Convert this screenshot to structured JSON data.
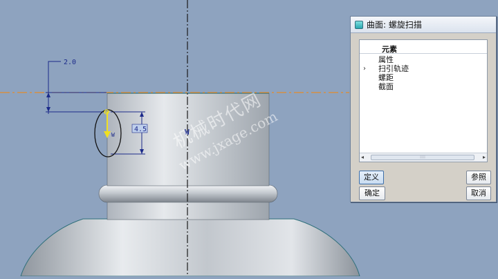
{
  "viewport": {
    "background_color": "#8ea3bf",
    "dimension_horizontal": "2.0",
    "dimension_height": "4.5",
    "axis_marker": "W",
    "cursor_marker": "W"
  },
  "watermark": {
    "line1": "机械时代网",
    "line2": "www.jxage.com"
  },
  "dialog": {
    "title": "曲面: 螺旋扫描",
    "tree": {
      "header": "元素",
      "items": [
        {
          "label": "属性",
          "expandable": false
        },
        {
          "label": "扫引轨迹",
          "expandable": true,
          "expander": "›"
        },
        {
          "label": "螺距",
          "expandable": false
        },
        {
          "label": "截面",
          "expandable": false
        }
      ]
    },
    "scroll": {
      "left": "◂",
      "right": "▸",
      "grip": "::::"
    },
    "buttons": {
      "define": "定义",
      "reference": "参照",
      "ok": "确定",
      "cancel": "取消"
    }
  },
  "colors": {
    "datum_line": "#e38a2b",
    "dimension": "#1b2a8a",
    "trajectory": "#f0e020",
    "axis_line": "#1a1a1a"
  }
}
